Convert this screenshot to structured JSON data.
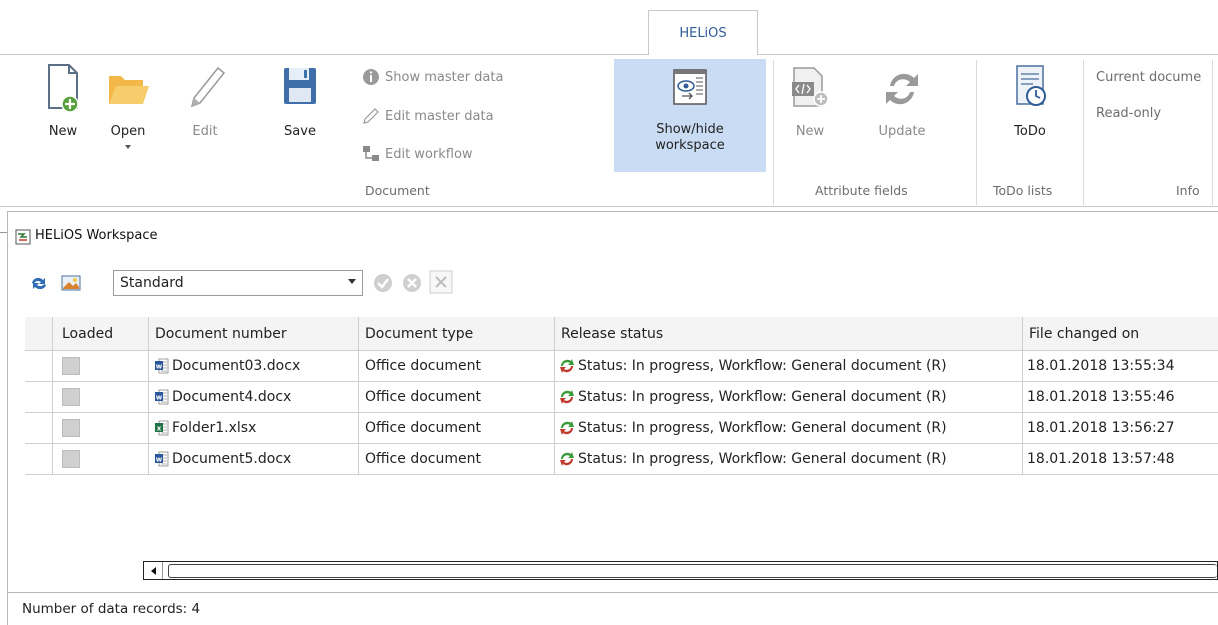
{
  "ribbon": {
    "tab": "HELiOS",
    "document_group": {
      "label": "Document",
      "new_label": "New",
      "open_label": "Open",
      "edit_label": "Edit",
      "save_label": "Save",
      "show_master_label": "Show master data",
      "edit_master_label": "Edit master data",
      "edit_workflow_label": "Edit workflow",
      "show_hide_line1": "Show/hide",
      "show_hide_line2": "workspace"
    },
    "attribute_group": {
      "label": "Attribute fields",
      "new_label": "New",
      "update_label": "Update"
    },
    "todo_group": {
      "label": "ToDo lists",
      "todo_label": "ToDo"
    },
    "info_group": {
      "label": "Info",
      "current_document": "Current docume",
      "read_only": "Read-only"
    }
  },
  "workspace": {
    "title": "HELiOS Workspace",
    "view_selected": "Standard",
    "columns": [
      "Loaded",
      "Document number",
      "Document type",
      "Release status",
      "File changed on"
    ],
    "rows": [
      {
        "loaded": false,
        "doc_number": "Document03.docx",
        "file_kind": "word",
        "doc_type": "Office document",
        "status": "Status: In progress, Workflow: General document (R)",
        "changed": "18.01.2018 13:55:34"
      },
      {
        "loaded": false,
        "doc_number": "Document4.docx",
        "file_kind": "word",
        "doc_type": "Office document",
        "status": "Status: In progress, Workflow: General document (R)",
        "changed": "18.01.2018 13:55:46"
      },
      {
        "loaded": false,
        "doc_number": "Folder1.xlsx",
        "file_kind": "excel",
        "doc_type": "Office document",
        "status": "Status: In progress, Workflow: General document (R)",
        "changed": "18.01.2018 13:56:27"
      },
      {
        "loaded": false,
        "doc_number": "Document5.docx",
        "file_kind": "word",
        "doc_type": "Office document",
        "status": "Status: In progress, Workflow: General document (R)",
        "changed": "18.01.2018 13:57:48"
      }
    ],
    "status_bar": "Number of data records: 4"
  },
  "colors": {
    "accent": "#2f5c97",
    "active_button": "#c9dcf3",
    "word_icon": "#2b579a",
    "excel_icon": "#217346"
  }
}
